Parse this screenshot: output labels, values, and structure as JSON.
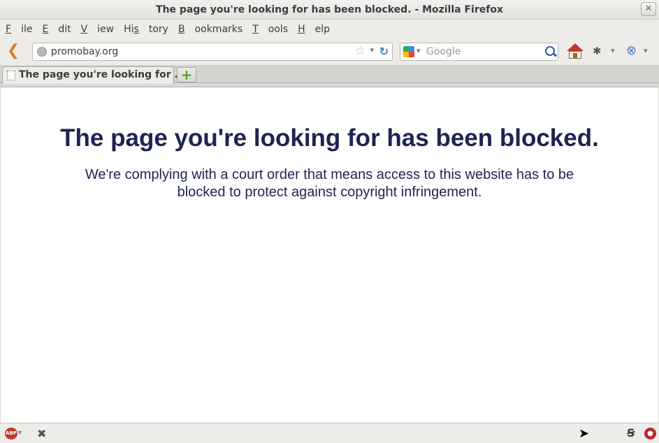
{
  "window": {
    "title": "The page you're looking for has been blocked. - Mozilla Firefox",
    "close_glyph": "✕"
  },
  "menu": [
    {
      "pre": "",
      "ul": "F",
      "post": "ile"
    },
    {
      "pre": "",
      "ul": "E",
      "post": "dit"
    },
    {
      "pre": "",
      "ul": "V",
      "post": "iew"
    },
    {
      "pre": "Hi",
      "ul": "s",
      "post": "tory"
    },
    {
      "pre": "",
      "ul": "B",
      "post": "ookmarks"
    },
    {
      "pre": "",
      "ul": "T",
      "post": "ools"
    },
    {
      "pre": "",
      "ul": "H",
      "post": "elp"
    }
  ],
  "navbar": {
    "url": "promobay.org",
    "search_placeholder": "Google",
    "icons": {
      "back": "back-icon",
      "site": "globe-icon",
      "bookmark": "star-icon",
      "reload": "reload-icon",
      "search_engine": "google-icon",
      "search": "search-icon",
      "home": "home-icon",
      "extension1": "bug-icon",
      "extension2": "tool-icon"
    }
  },
  "tabs": [
    {
      "label": "The page you're looking for ..."
    }
  ],
  "new_tab_glyph": "+",
  "content": {
    "heading": "The page you're looking for has been blocked.",
    "message": "We're complying with a court order that means access to this website has to be blocked to protect against copyright infringement."
  },
  "statusbar": {
    "abp_label": "ABP",
    "icons": [
      "adblock-icon",
      "close-icon",
      "cursor-icon",
      "s-icon",
      "red-extension-icon"
    ]
  },
  "colors": {
    "heading": "#1d2452",
    "back_arrow": "#e07a1f",
    "reload": "#3f7bd0",
    "new_tab": "#5ca324"
  }
}
